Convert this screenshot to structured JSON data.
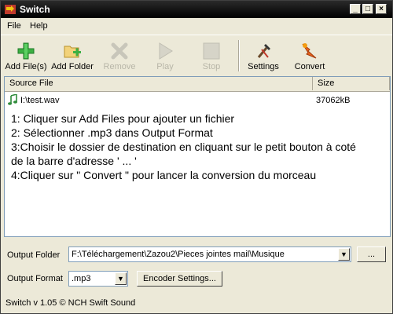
{
  "window": {
    "title": "Switch"
  },
  "titlebar_buttons": {
    "minimize": "_",
    "maximize": "□",
    "close": "×"
  },
  "menu": [
    {
      "label": "File"
    },
    {
      "label": "Help"
    }
  ],
  "toolbar": {
    "add_files": "Add File(s)",
    "add_folder": "Add Folder",
    "remove": "Remove",
    "play": "Play",
    "stop": "Stop",
    "settings": "Settings",
    "convert": "Convert"
  },
  "file_list": {
    "columns": {
      "source": "Source File",
      "size": "Size"
    },
    "rows": [
      {
        "name": "I:\\test.wav",
        "size": "37062kB"
      }
    ]
  },
  "instructions": [
    "1: Cliquer sur Add Files pour ajouter un fichier",
    "2: Sélectionner .mp3 dans Output Format",
    "3:Choisir le dossier de destination en cliquant sur le petit bouton à coté",
    "de la barre d'adresse ' ... '",
    "4:Cliquer sur \" Convert \" pour lancer la conversion du morceau"
  ],
  "output_folder": {
    "label": "Output Folder",
    "value": "F:\\Téléchargement\\Zazou2\\Pieces jointes mail\\Musique",
    "browse": "..."
  },
  "output_format": {
    "label": "Output Format",
    "value": ".mp3",
    "encoder_settings": "Encoder Settings..."
  },
  "status_bar": "Switch v 1.05 © NCH Swift Sound",
  "colors": {
    "titlebar": "#000000",
    "window": "#ece9d8",
    "add_green": "#3cb043",
    "convert_orange": "#e8641e"
  }
}
